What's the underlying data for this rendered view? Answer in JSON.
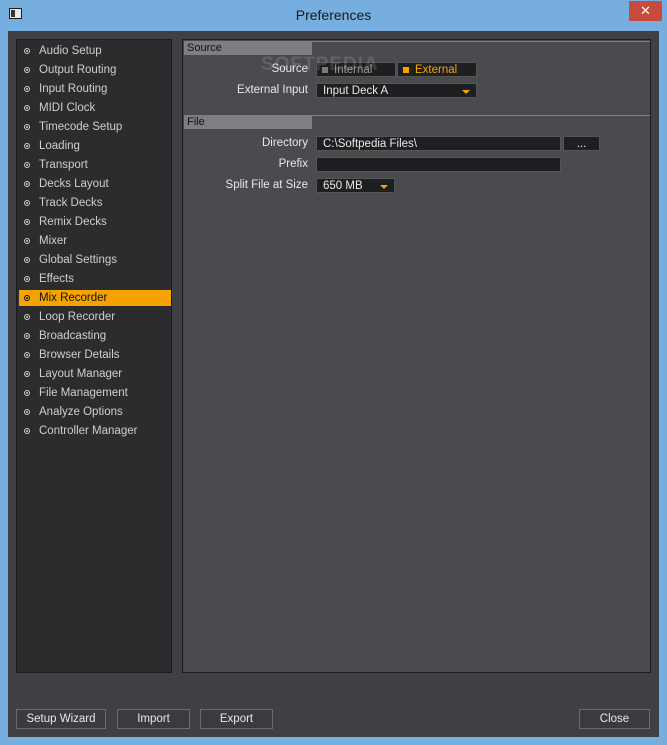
{
  "window": {
    "title": "Preferences",
    "close_glyph": "✕"
  },
  "sidebar": {
    "items": [
      {
        "label": "Audio Setup"
      },
      {
        "label": "Output Routing"
      },
      {
        "label": "Input Routing"
      },
      {
        "label": "MIDI Clock"
      },
      {
        "label": "Timecode Setup"
      },
      {
        "label": "Loading"
      },
      {
        "label": "Transport"
      },
      {
        "label": "Decks Layout"
      },
      {
        "label": "Track Decks"
      },
      {
        "label": "Remix Decks"
      },
      {
        "label": "Mixer"
      },
      {
        "label": "Global Settings"
      },
      {
        "label": "Effects"
      },
      {
        "label": "Mix Recorder"
      },
      {
        "label": "Loop Recorder"
      },
      {
        "label": "Broadcasting"
      },
      {
        "label": "Browser Details"
      },
      {
        "label": "Layout Manager"
      },
      {
        "label": "File Management"
      },
      {
        "label": "Analyze Options"
      },
      {
        "label": "Controller Manager"
      }
    ],
    "active_index": 13
  },
  "source": {
    "header": "Source",
    "source_label": "Source",
    "internal_label": "Internal",
    "external_label": "External",
    "selected": "External",
    "external_input_label": "External Input",
    "external_input_value": "Input Deck A"
  },
  "file": {
    "header": "File",
    "directory_label": "Directory",
    "directory_value": "C:\\Softpedia Files\\",
    "browse_label": "...",
    "prefix_label": "Prefix",
    "prefix_value": "",
    "split_label": "Split File at Size",
    "split_value": "650 MB"
  },
  "watermark": "SOFTPEDIA",
  "footer": {
    "setup_wizard": "Setup Wizard",
    "import": "Import",
    "export": "Export",
    "close": "Close"
  },
  "colors": {
    "accent": "#f5a300",
    "panel": "#4a4b4e",
    "sidebar": "#2b2c2e"
  }
}
